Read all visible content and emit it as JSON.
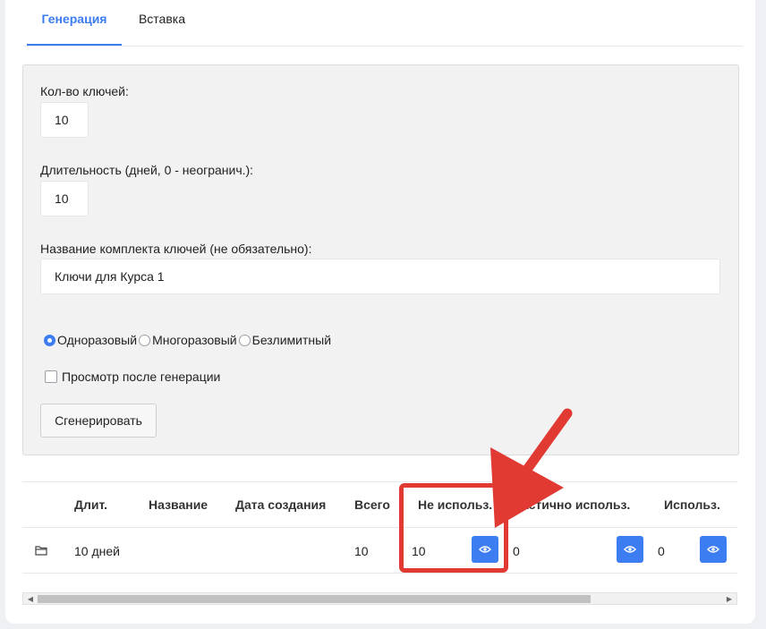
{
  "tabs": [
    {
      "label": "Генерация",
      "active": true
    },
    {
      "label": "Вставка",
      "active": false
    }
  ],
  "form": {
    "count_label": "Кол-во ключей:",
    "count_value": "10",
    "duration_label": "Длительность (дней, 0 - неогранич.):",
    "duration_value": "10",
    "name_label": "Название комплекта ключей (не обязательно):",
    "name_value": "Ключи для Курса 1",
    "radios": [
      {
        "label": "Одноразовый",
        "checked": true
      },
      {
        "label": "Многоразовый",
        "checked": false
      },
      {
        "label": "Безлимитный",
        "checked": false
      }
    ],
    "checkbox_label": "Просмотр после генерации",
    "checkbox_checked": false,
    "generate_button": "Сгенерировать"
  },
  "table": {
    "headers": [
      "Длит.",
      "Название",
      "Дата создания",
      "Всего",
      "Не использ.",
      "Частично использ.",
      "Использ."
    ],
    "rows": [
      {
        "icon": "folder-icon",
        "duration": "10 дней",
        "name": "",
        "created": "",
        "total": "10",
        "unused": "10",
        "partial": "0",
        "used": "0"
      }
    ]
  },
  "colors": {
    "accent": "#3d7df2",
    "annotation": "#e03a33"
  }
}
